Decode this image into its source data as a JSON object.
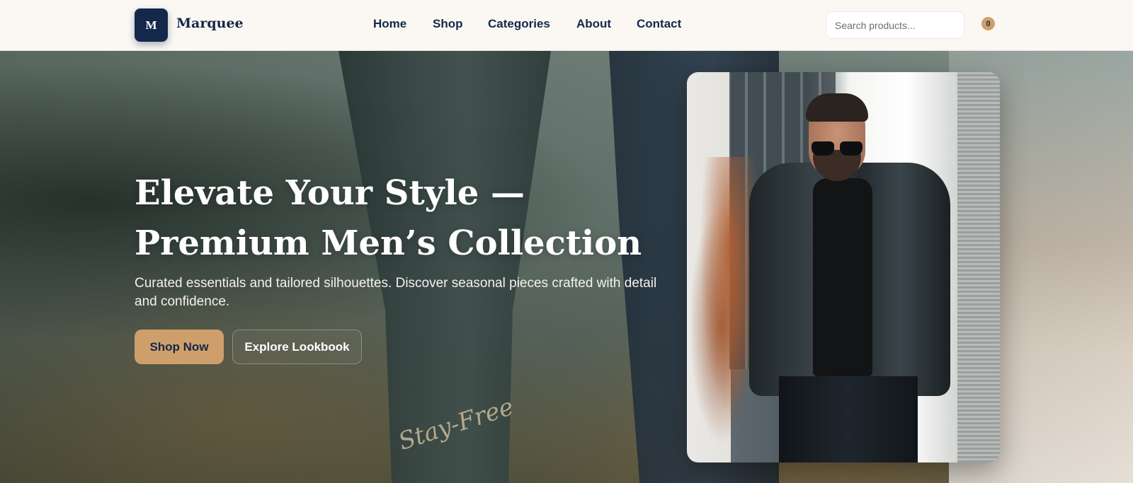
{
  "header": {
    "logo_letter": "M",
    "brand": "Marquee",
    "nav": [
      {
        "label": "Home"
      },
      {
        "label": "Shop"
      },
      {
        "label": "Categories"
      },
      {
        "label": "About"
      },
      {
        "label": "Contact"
      }
    ],
    "search": {
      "placeholder": "Search products...",
      "value": ""
    },
    "cart": {
      "count": "0",
      "icon": "cart-icon"
    }
  },
  "hero": {
    "headline": "Elevate Your Style — Premium Men’s Collection",
    "subcopy": "Curated essentials and tailored silhouettes. Discover seasonal pieces crafted with detail and confidence.",
    "primary_cta": "Shop Now",
    "secondary_cta": "Explore Lookbook",
    "background_stitch_text": "Stay-Free"
  },
  "colors": {
    "brand_navy": "#14284a",
    "accent_tan": "#cf9f6b",
    "header_bg": "#fbf8f4",
    "text_light": "#ffffff"
  }
}
